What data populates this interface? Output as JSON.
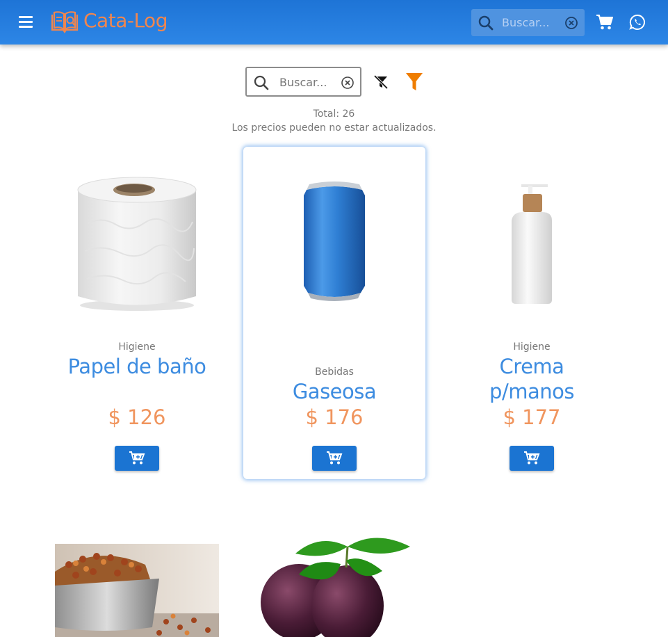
{
  "header": {
    "brand": "Cata-Log",
    "search_placeholder": "Buscar...",
    "icons": [
      "menu-icon",
      "book-logo-icon",
      "search-icon",
      "clear-icon",
      "cart-icon",
      "whatsapp-icon"
    ],
    "colors": {
      "bar": "#1e74d6",
      "brand": "#f0864f"
    }
  },
  "search": {
    "placeholder": "Buscar...",
    "icons": [
      "search-icon",
      "clear-icon",
      "filter-off-icon",
      "filter-icon"
    ],
    "filter_color": "#ef7d00"
  },
  "summary": {
    "total": "Total: 26",
    "disclaimer": "Los precios pueden no estar actualizados."
  },
  "products": [
    {
      "category": "Higiene",
      "name": "Papel de baño",
      "price": "$ 126",
      "image": "toilet-paper"
    },
    {
      "category": "Bebidas",
      "name": "Gaseosa",
      "price": "$ 176",
      "image": "blue-can"
    },
    {
      "category": "Higiene",
      "name": "Crema p/manos",
      "price": "$ 177",
      "image": "lotion-bottle"
    }
  ],
  "bottom_row": [
    {
      "image": "pet-food-bowl"
    },
    {
      "image": "passion-fruit"
    }
  ],
  "colors": {
    "product_name": "#3d8ce0",
    "price": "#f0955e",
    "add_button": "#1b74d2"
  }
}
